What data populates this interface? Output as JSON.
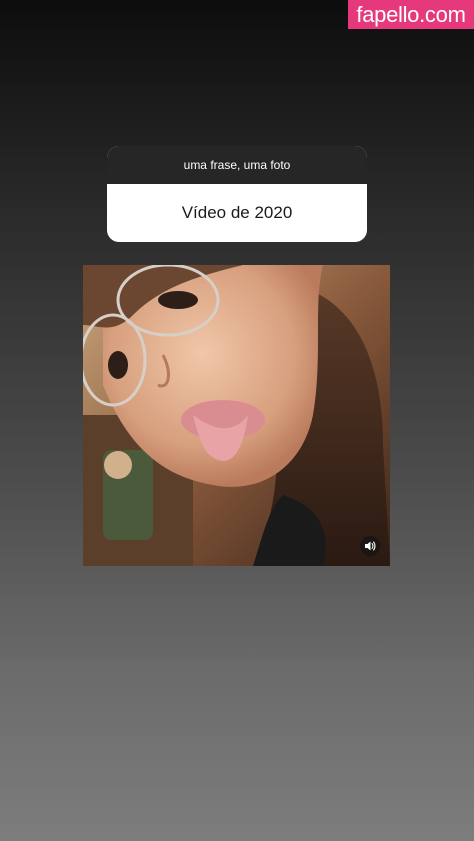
{
  "watermark": {
    "text": "fapello.com",
    "color": "#e6397b"
  },
  "question_sticker": {
    "prompt": "uma frase, uma foto",
    "answer": "Vídeo de 2020"
  },
  "media": {
    "type": "video",
    "sound_icon": "speaker-icon"
  }
}
